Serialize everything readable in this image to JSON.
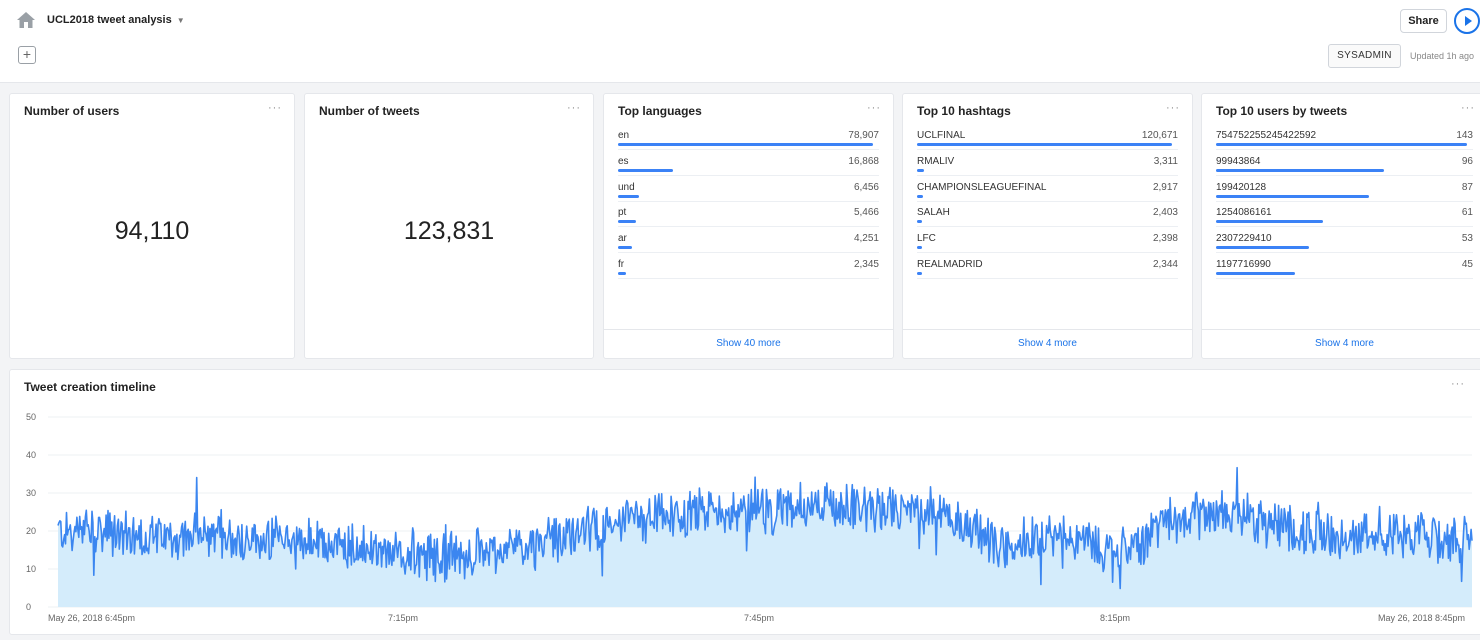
{
  "header": {
    "title": "UCL2018 tweet analysis",
    "share_label": "Share",
    "org_label": "SYSADMIN",
    "updated_text": "Updated 1h ago",
    "icons": {
      "home": "home-icon",
      "add": "plus-icon",
      "play": "play-icon",
      "caret": "caret-down-icon"
    }
  },
  "cards": {
    "users": {
      "title": "Number of users",
      "value": "94,110",
      "menu": "···"
    },
    "tweets": {
      "title": "Number of tweets",
      "value": "123,831",
      "menu": "···"
    },
    "languages": {
      "title": "Top languages",
      "menu": "···",
      "show_more": "Show 40 more",
      "items": [
        {
          "label": "en",
          "value": "78,907",
          "share": 1.0
        },
        {
          "label": "es",
          "value": "16,868",
          "share": 0.214
        },
        {
          "label": "und",
          "value": "6,456",
          "share": 0.082
        },
        {
          "label": "pt",
          "value": "5,466",
          "share": 0.069
        },
        {
          "label": "ar",
          "value": "4,251",
          "share": 0.054
        },
        {
          "label": "fr",
          "value": "2,345",
          "share": 0.03
        }
      ]
    },
    "hashtags": {
      "title": "Top 10 hashtags",
      "menu": "···",
      "show_more": "Show 4 more",
      "items": [
        {
          "label": "UCLFINAL",
          "value": "120,671",
          "share": 1.0
        },
        {
          "label": "RMALIV",
          "value": "3,311",
          "share": 0.027
        },
        {
          "label": "CHAMPIONSLEAGUEFINAL",
          "value": "2,917",
          "share": 0.024
        },
        {
          "label": "SALAH",
          "value": "2,403",
          "share": 0.02
        },
        {
          "label": "LFC",
          "value": "2,398",
          "share": 0.02
        },
        {
          "label": "REALMADRID",
          "value": "2,344",
          "share": 0.019
        }
      ]
    },
    "top_users": {
      "title": "Top 10 users by tweets",
      "menu": "···",
      "show_more": "Show 4 more",
      "items": [
        {
          "label": "754752255245422592",
          "value": "143",
          "share": 1.0
        },
        {
          "label": "99943864",
          "value": "96",
          "share": 0.671
        },
        {
          "label": "199420128",
          "value": "87",
          "share": 0.608
        },
        {
          "label": "1254086161",
          "value": "61",
          "share": 0.427
        },
        {
          "label": "2307229410",
          "value": "53",
          "share": 0.371
        },
        {
          "label": "1197716990",
          "value": "45",
          "share": 0.315
        }
      ]
    }
  },
  "timeline": {
    "title": "Tweet creation timeline",
    "menu": "···"
  },
  "chart_data": {
    "type": "area",
    "title": "Tweet creation timeline",
    "xlabel": "",
    "ylabel": "",
    "ylim": [
      0,
      50
    ],
    "y_ticks": [
      0,
      10,
      20,
      30,
      40,
      50
    ],
    "x_tick_labels": [
      "May 26, 2018 6:45pm",
      "7:15pm",
      "7:45pm",
      "8:15pm",
      "May 26, 2018 8:45pm"
    ],
    "grid": true,
    "color": "#3b86f0",
    "fill_color": "#d4ecfb",
    "x": [
      "6:45pm",
      "6:50pm",
      "6:55pm",
      "7:00pm",
      "7:05pm",
      "7:10pm",
      "7:15pm",
      "7:20pm",
      "7:25pm",
      "7:30pm",
      "7:35pm",
      "7:40pm",
      "7:45pm",
      "7:50pm",
      "7:55pm",
      "8:00pm",
      "8:05pm",
      "8:10pm",
      "8:15pm",
      "8:20pm",
      "8:25pm",
      "8:30pm",
      "8:35pm",
      "8:40pm",
      "8:45pm"
    ],
    "values": [
      20,
      19,
      18,
      18,
      17,
      16,
      13,
      14,
      16,
      20,
      23,
      25,
      25,
      26,
      25,
      25,
      16,
      20,
      14,
      24,
      25,
      20,
      19,
      18,
      18
    ],
    "noise_amplitude": 6
  }
}
